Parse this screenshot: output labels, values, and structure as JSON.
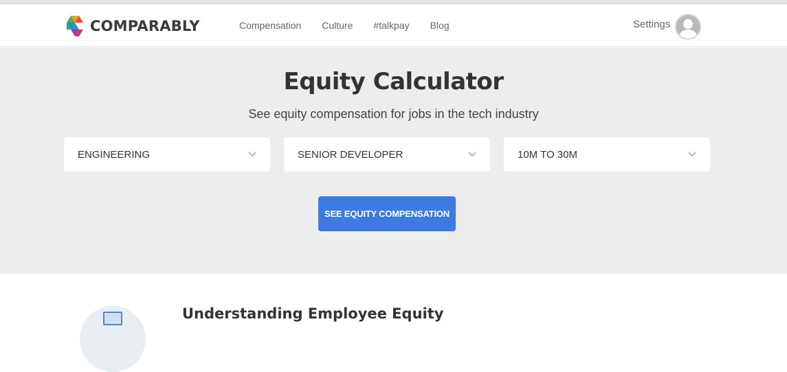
{
  "header": {
    "logo_text": "COMPARABLY",
    "nav": [
      {
        "label": "Compensation"
      },
      {
        "label": "Culture"
      },
      {
        "label": "#talkpay"
      },
      {
        "label": "Blog"
      }
    ],
    "settings_label": "Settings"
  },
  "hero": {
    "title": "Equity Calculator",
    "subtitle": "See equity compensation for jobs in the tech industry",
    "selects": [
      {
        "value": "ENGINEERING"
      },
      {
        "value": "SENIOR DEVELOPER"
      },
      {
        "value": "10M TO 30M"
      }
    ],
    "cta_label": "SEE EQUITY COMPENSATION"
  },
  "section": {
    "heading": "Understanding Employee Equity"
  },
  "colors": {
    "hero_bg": "#ededee",
    "cta_bg": "#3d7be2",
    "logo_orange": "#f39b2b",
    "logo_green": "#4caf50",
    "logo_blue": "#2d8fd6",
    "logo_purple": "#8e44ad"
  },
  "icons": [
    "comparably-logo-icon",
    "avatar-icon",
    "chevron-down-icon"
  ]
}
